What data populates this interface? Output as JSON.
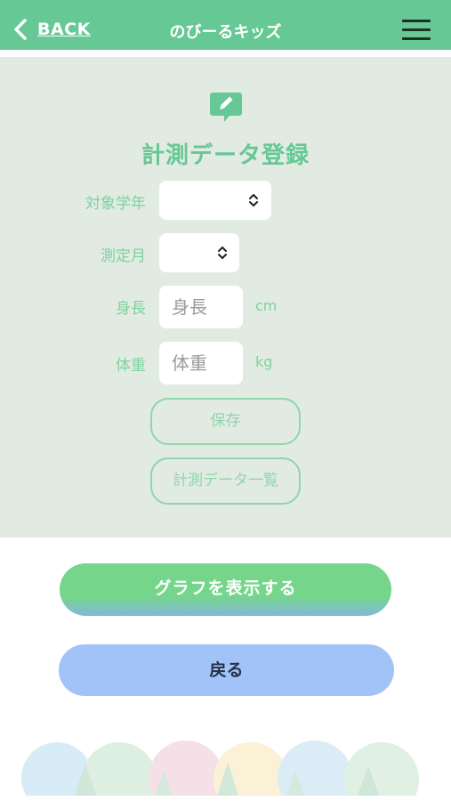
{
  "header": {
    "back_label": "BACK",
    "app_title": "のびーるキッズ",
    "icons": {
      "back": "chevron-left-icon",
      "menu": "hamburger-menu-icon"
    }
  },
  "form": {
    "icon": "pencil-speech-bubble-icon",
    "title": "計測データ登録",
    "fields": {
      "grade": {
        "label": "対象学年",
        "value": ""
      },
      "month": {
        "label": "測定月",
        "value": ""
      },
      "height": {
        "label": "身長",
        "placeholder": "身長",
        "unit": "cm"
      },
      "weight": {
        "label": "体重",
        "placeholder": "体重",
        "unit": "kg"
      }
    },
    "save_label": "保存",
    "list_label": "計測データ一覧"
  },
  "actions": {
    "graph_label": "グラフを表示する",
    "return_label": "戻る"
  },
  "colors": {
    "header": "#66c894",
    "panel": "#e1ebe2",
    "accent_green": "#66c894",
    "label_green": "#7dd19e",
    "graph_button": "#75d68b",
    "return_button": "#a1c3f7"
  }
}
